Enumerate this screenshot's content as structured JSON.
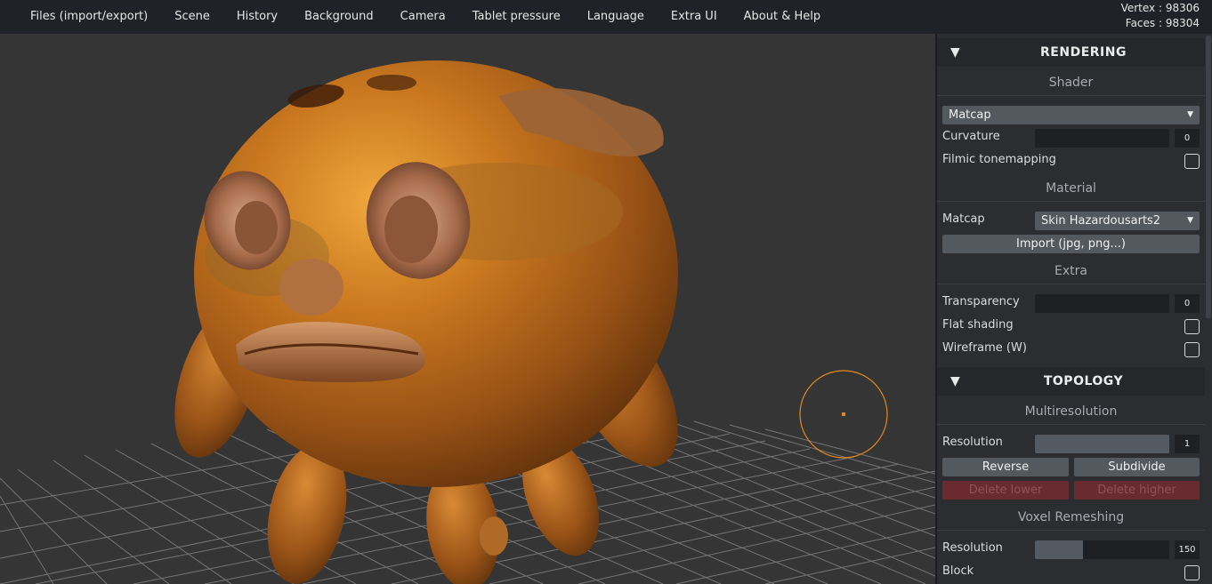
{
  "menu": {
    "items": [
      "Files (import/export)",
      "Scene",
      "History",
      "Background",
      "Camera",
      "Tablet pressure",
      "Language",
      "Extra UI",
      "About & Help"
    ]
  },
  "stats": {
    "vertex": "Vertex : 98306",
    "faces": "Faces : 98304"
  },
  "rendering": {
    "arrow": "▼",
    "title": "RENDERING",
    "shader": {
      "heading": "Shader",
      "select_value": "Matcap",
      "curvature_label": "Curvature",
      "curvature_value": "0",
      "curvature_fraction": 0,
      "filmic_label": "Filmic tonemapping",
      "filmic_checked": false
    },
    "material": {
      "heading": "Material",
      "matcap_label": "Matcap",
      "matcap_value": "Skin Hazardousarts2",
      "import_label": "Import (jpg, png...)"
    },
    "extra": {
      "heading": "Extra",
      "transparency_label": "Transparency",
      "transparency_value": "0",
      "transparency_fraction": 0,
      "flat_label": "Flat shading",
      "flat_checked": false,
      "wireframe_label": "Wireframe (W)",
      "wireframe_checked": false
    }
  },
  "topology": {
    "arrow": "▼",
    "title": "TOPOLOGY",
    "multires": {
      "heading": "Multiresolution",
      "resolution_label": "Resolution",
      "resolution_value": "1",
      "resolution_fraction": 1.0,
      "reverse_label": "Reverse",
      "subdivide_label": "Subdivide",
      "delete_lower_label": "Delete lower",
      "delete_higher_label": "Delete higher"
    },
    "voxel": {
      "heading": "Voxel Remeshing",
      "resolution_label": "Resolution",
      "resolution_value": "150",
      "resolution_fraction": 0.36,
      "block_label": "Block",
      "block_checked": false
    }
  },
  "colors": {
    "accent_brush": "#e08a1c",
    "danger_button": "#6a2b30",
    "panel_bg": "#2b2d31",
    "topbar_bg": "#1f2226"
  }
}
